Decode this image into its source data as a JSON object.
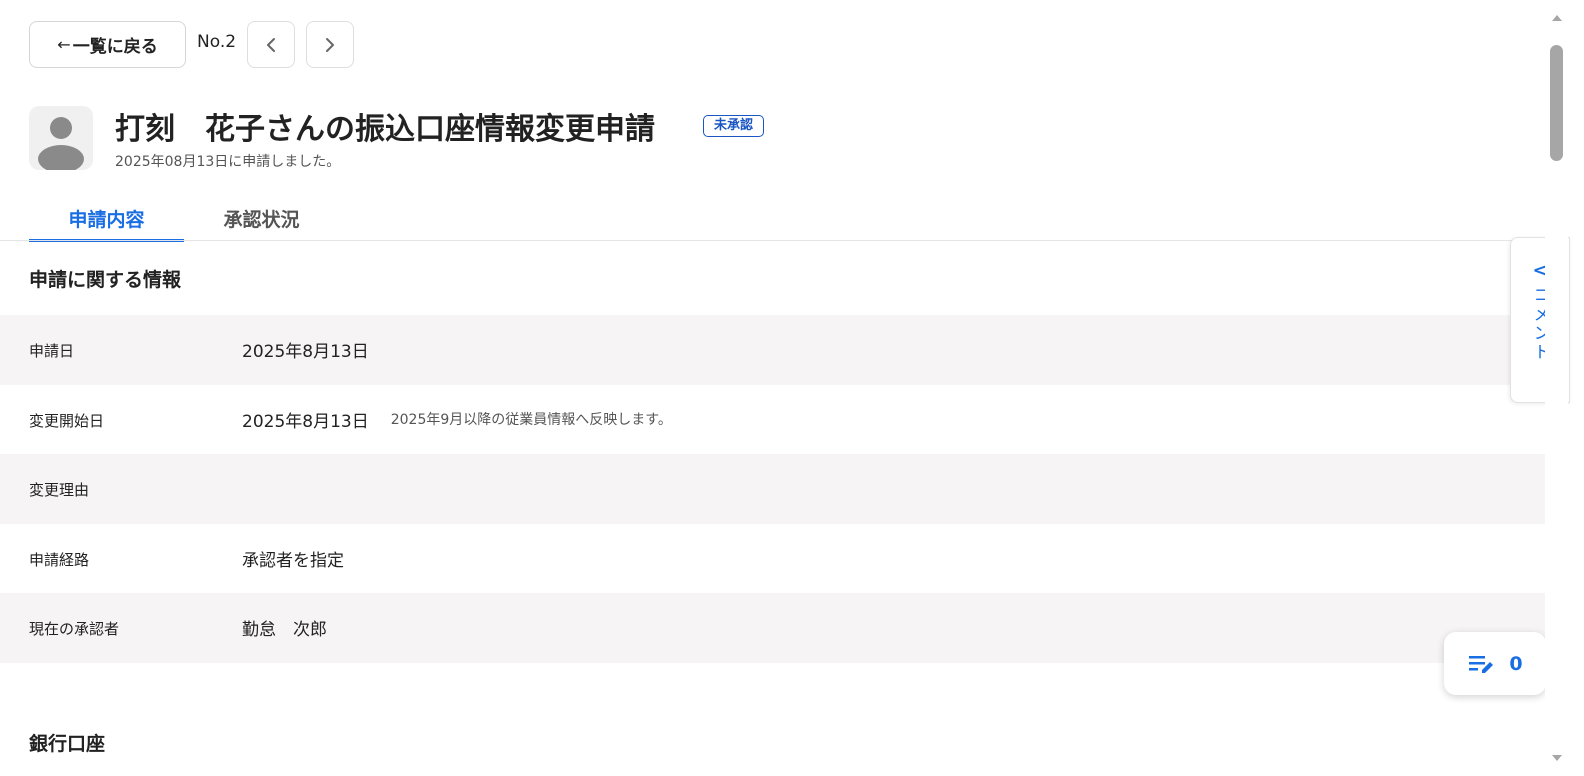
{
  "nav": {
    "back_arrow": "←",
    "back_label": "一覧に戻る",
    "record_no": "No.2"
  },
  "header": {
    "title": "打刻　花子さんの振込口座情報変更申請",
    "status_badge": "未承認",
    "subtitle": "2025年08月13日に申請しました。",
    "avatar_icon": "user-avatar-icon"
  },
  "tabs": [
    {
      "label": "申請内容",
      "active": true
    },
    {
      "label": "承認状況",
      "active": false
    }
  ],
  "sections": {
    "application_info_title": "申請に関する情報",
    "bank_account_title": "銀行口座"
  },
  "info_rows": [
    {
      "label": "申請日",
      "value": "2025年8月13日",
      "note": ""
    },
    {
      "label": "変更開始日",
      "value": "2025年8月13日",
      "note": "2025年9月以降の従業員情報へ反映します。"
    },
    {
      "label": "変更理由",
      "value": "",
      "note": ""
    },
    {
      "label": "申請経路",
      "value": "承認者を指定",
      "note": ""
    },
    {
      "label": "現在の承認者",
      "value": "勤怠　次郎",
      "note": ""
    }
  ],
  "comment_panel": {
    "chevron": "<",
    "label": "コメント"
  },
  "memo": {
    "icon": "edit-note-icon",
    "count": "0"
  },
  "colors": {
    "accent": "#1a6ee3",
    "badge": "#1a55c4",
    "row_shade": "#f6f4f4"
  }
}
